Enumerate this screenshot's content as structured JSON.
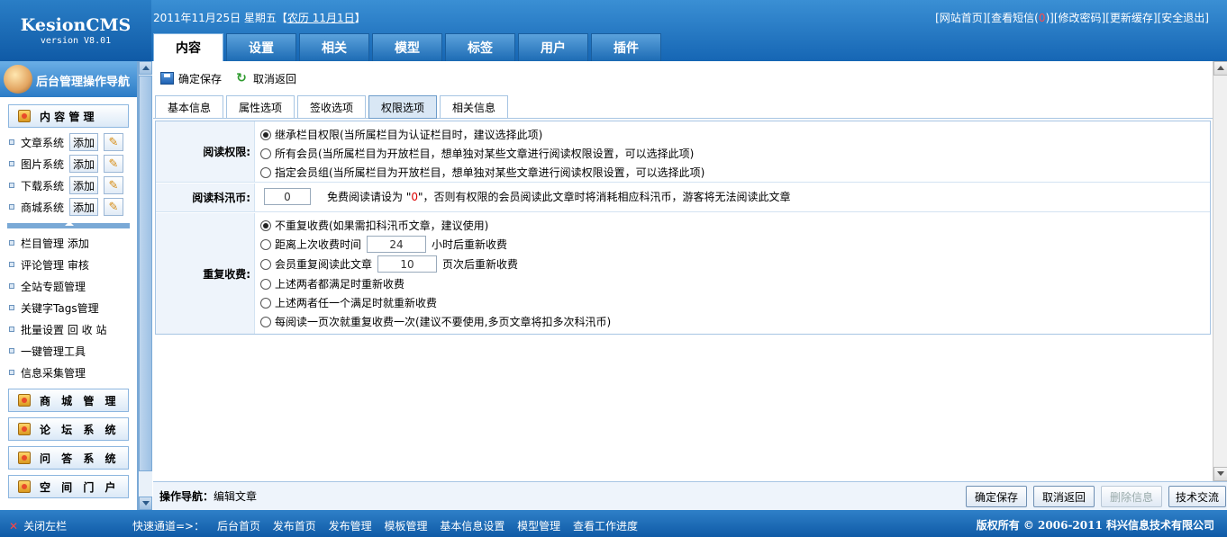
{
  "logo": {
    "name": "KesionCMS",
    "version": "version V8.01"
  },
  "datebar": {
    "text": "2011年11月25日 星期五【",
    "lunar": "农历 11月1日",
    "close": "】"
  },
  "toplinks": {
    "home": "[网站首页]",
    "msg_prefix": "[查看短信(",
    "msg_count": "0",
    "msg_suffix": ")]",
    "password": "[修改密码]",
    "cache": "[更新缓存]",
    "logout": "[安全退出]"
  },
  "maintabs": [
    "内容",
    "设置",
    "相关",
    "模型",
    "标签",
    "用户",
    "插件"
  ],
  "sidebar": {
    "title": "后台管理操作导航",
    "content_group": "内 容 管 理",
    "systems": [
      {
        "label": "文章系统",
        "add": "添加"
      },
      {
        "label": "图片系统",
        "add": "添加"
      },
      {
        "label": "下载系统",
        "add": "添加"
      },
      {
        "label": "商城系统",
        "add": "添加"
      }
    ],
    "nav": [
      "栏目管理 添加",
      "评论管理 审核",
      "全站专题管理",
      "关键字Tags管理",
      "批量设置 回 收 站",
      "一键管理工具",
      "信息采集管理"
    ],
    "groups": [
      "商 城 管 理",
      "论 坛 系 统",
      "问 答 系 统",
      "空 间 门 户"
    ]
  },
  "toolbar": {
    "save": "确定保存",
    "back": "取消返回"
  },
  "subtabs": [
    "基本信息",
    "属性选项",
    "签收选项",
    "权限选项",
    "相关信息"
  ],
  "form": {
    "read_perm": {
      "label": "阅读权限:",
      "options": [
        "继承栏目权限(当所属栏目为认证栏目时，建议选择此项)",
        "所有会员(当所属栏目为开放栏目，想单独对某些文章进行阅读权限设置，可以选择此项)",
        "指定会员组(当所属栏目为开放栏目，想单独对某些文章进行阅读权限设置，可以选择此项)"
      ]
    },
    "coins": {
      "label": "阅读科汛币:",
      "value": "0",
      "text_before": "免费阅读请设为 \"",
      "zero": "0",
      "text_after": "\"，否则有权限的会员阅读此文章时将消耗相应科汛币，游客将无法阅读此文章"
    },
    "repeat": {
      "label": "重复收费:",
      "opt1": "不重复收费(如果需扣科汛币文章，建议使用)",
      "opt2_before": "距离上次收费时间",
      "opt2_value": "24",
      "opt2_after": "小时后重新收费",
      "opt3_before": "会员重复阅读此文章",
      "opt3_value": "10",
      "opt3_after": "页次后重新收费",
      "opt4": "上述两者都满足时重新收费",
      "opt5": "上述两者任一个满足时就重新收费",
      "opt6": "每阅读一页次就重复收费一次(建议不要使用,多页文章将扣多次科汛币)"
    }
  },
  "opbar": {
    "nav_label": "操作导航：",
    "nav_value": "编辑文章",
    "save": "确定保存",
    "back": "取消返回",
    "delete": "删除信息",
    "tech": "技术交流"
  },
  "footer": {
    "close": "关闭左栏",
    "quick_label": "快速通道=>：",
    "quick": [
      "后台首页",
      "发布首页",
      "发布管理",
      "模板管理",
      "基本信息设置",
      "模型管理",
      "查看工作进度"
    ],
    "copyright": "版权所有 © 2006-2011 科兴信息技术有限公司"
  }
}
